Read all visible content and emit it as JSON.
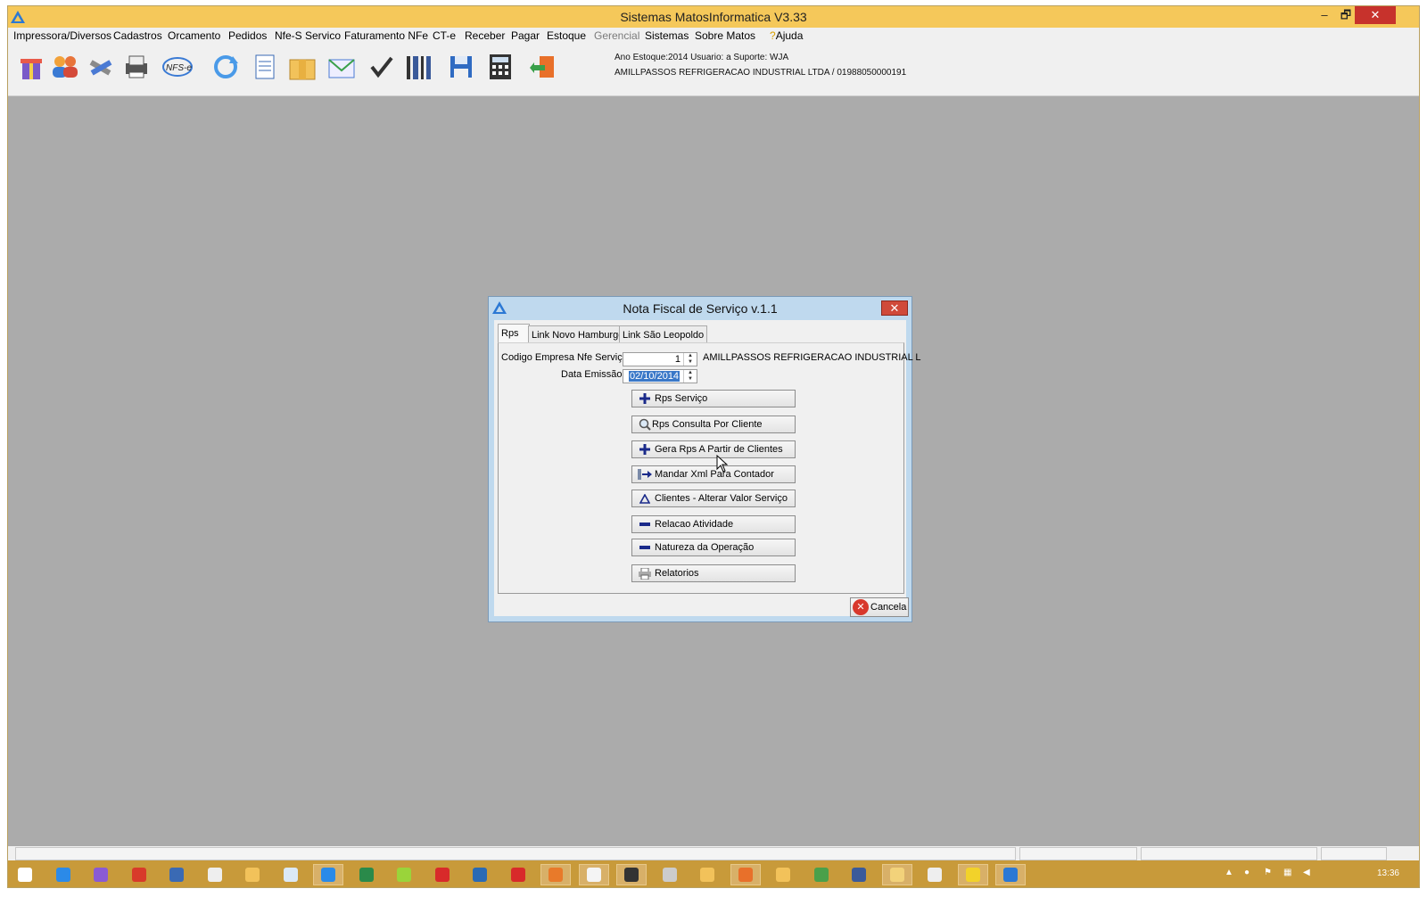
{
  "app": {
    "title": "Sistemas MatosInformatica V3.33",
    "minimize": "‒",
    "restore": "🗗",
    "close": "✕"
  },
  "menu": [
    {
      "label": "Impressora/Diversos"
    },
    {
      "label": "Cadastros"
    },
    {
      "label": "Orcamento"
    },
    {
      "label": "Pedidos"
    },
    {
      "label": "Nfe-S Servico"
    },
    {
      "label": "Faturamento NFe"
    },
    {
      "label": "CT-e"
    },
    {
      "label": "Receber"
    },
    {
      "label": "Pagar"
    },
    {
      "label": "Estoque"
    },
    {
      "label": "Gerencial",
      "disabled": true
    },
    {
      "label": "Sistemas"
    },
    {
      "label": "Sobre Matos"
    },
    {
      "label": "Ajuda"
    }
  ],
  "toolbar": {
    "icons": [
      "gift-box-icon",
      "users-icon",
      "tools-icon",
      "printer-icon",
      "nfse-icon",
      "refresh-icon",
      "notepad-icon",
      "package-icon",
      "mail-icon",
      "checklist-icon",
      "barcode-icon",
      "save-icon",
      "calculator-icon",
      "exit-icon"
    ],
    "nfse_text": "NFS-e",
    "info_line1": "Ano Estoque:2014 Usuario: a Suporte: WJA",
    "info_line2": "AMILLPASSOS REFRIGERACAO INDUSTRIAL LTDA / 01988050000191"
  },
  "dialog": {
    "title": "Nota Fiscal de Serviço v.1.1",
    "close": "✕",
    "tabs": [
      {
        "label": "Rps",
        "selected": true
      },
      {
        "label": "Link Novo Hamburgo"
      },
      {
        "label": "Link São Leopoldo"
      }
    ],
    "codigo_label": "Codigo Empresa Nfe Serviço:",
    "codigo_value": "1",
    "empresa_name": "AMILLPASSOS REFRIGERACAO INDUSTRIAL L",
    "data_label": "Data Emissão:",
    "data_value": "02/10/2014",
    "buttons": [
      {
        "label": "Rps Serviço",
        "icon": "plus-icon"
      },
      {
        "label": "Rps Consulta Por Cliente",
        "icon": "magnifier-icon"
      },
      {
        "label": "Gera Rps A Partir de Clientes",
        "icon": "plus-icon"
      },
      {
        "label": "Mandar Xml Para Contador",
        "icon": "send-arrow-icon"
      },
      {
        "label": "Clientes - Alterar Valor Serviço",
        "icon": "triangle-icon"
      },
      {
        "label": "Relacao Atividade",
        "icon": "minus-icon"
      },
      {
        "label": "Natureza da Operação",
        "icon": "minus-icon"
      },
      {
        "label": "Relatorios",
        "icon": "printer-icon"
      }
    ],
    "cancel_label": "Cancela"
  },
  "taskbar": {
    "icons": [
      "start-icon",
      "internet-explorer-icon",
      "visual-studio-icon",
      "filezilla-icon",
      "remote-desktop-icon",
      "calculator-icon",
      "folder-tools-icon",
      "notepad-icon",
      "skype-icon",
      "excel-icon",
      "android-icon",
      "acrobat-icon",
      "browser-icon",
      "opera-icon",
      "app-icon",
      "editor-icon",
      "terminal-icon",
      "disc-icon",
      "gear-icon",
      "firefox-icon",
      "settings-icon",
      "chrome-icon",
      "network-icon",
      "file-explorer-icon",
      "spreadsheet-icon",
      "norton-icon",
      "matos-app-icon"
    ],
    "clock": "13:36"
  },
  "colors": {
    "titlebar": "#f5c85a",
    "taskbar": "#c89a3a",
    "dialog_frame": "#bfd9ee",
    "selection": "#3a78c8"
  }
}
